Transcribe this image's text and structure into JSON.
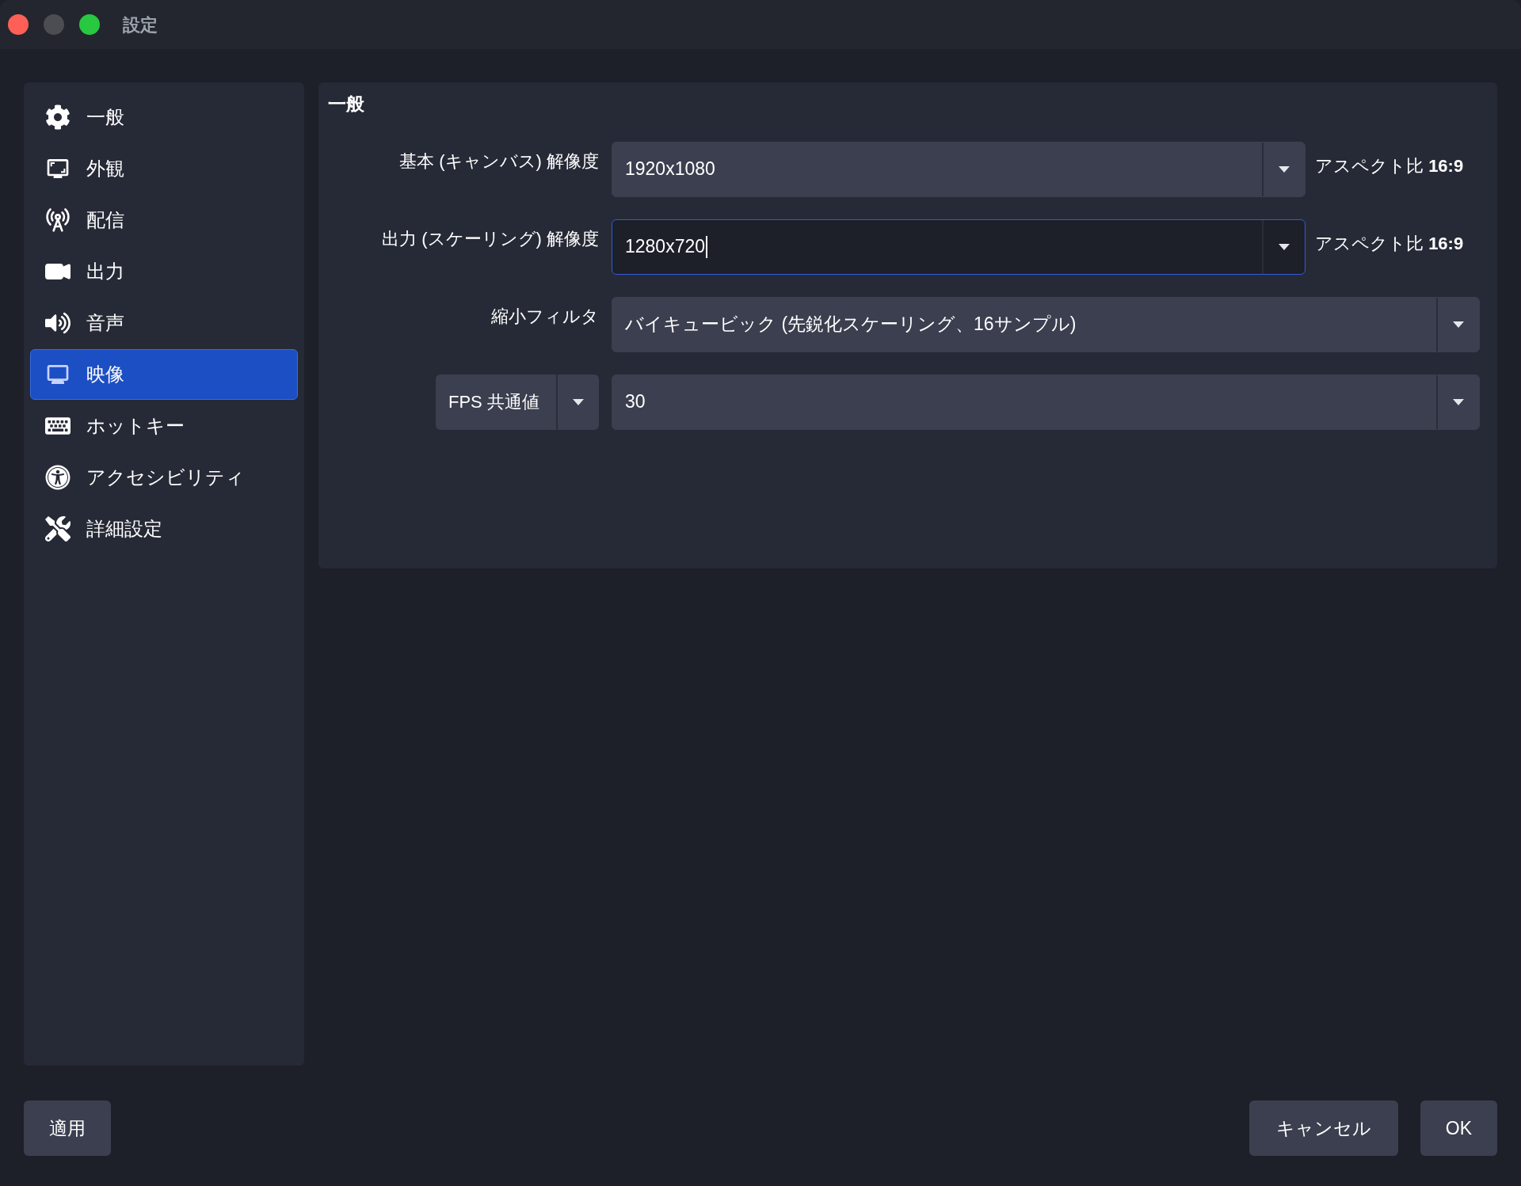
{
  "window": {
    "title": "設定"
  },
  "sidebar": {
    "items": [
      {
        "label": "一般",
        "selected": false
      },
      {
        "label": "外観",
        "selected": false
      },
      {
        "label": "配信",
        "selected": false
      },
      {
        "label": "出力",
        "selected": false
      },
      {
        "label": "音声",
        "selected": false
      },
      {
        "label": "映像",
        "selected": true
      },
      {
        "label": "ホットキー",
        "selected": false
      },
      {
        "label": "アクセシビリティ",
        "selected": false
      },
      {
        "label": "詳細設定",
        "selected": false
      }
    ]
  },
  "section": {
    "title": "一般",
    "rows": [
      {
        "label": "基本 (キャンバス) 解像度",
        "value": "1920x1080",
        "focused": false,
        "note": "アスペクト比 **16:9**"
      },
      {
        "label": "出力 (スケーリング) 解像度",
        "value": "1280x720",
        "focused": true,
        "note": "アスペクト比 **16:9**"
      },
      {
        "label": "縮小フィルタ",
        "value": "バイキュービック (先鋭化スケーリング、16サンプル)",
        "focused": false
      },
      {
        "label_select": "FPS 共通値",
        "value": "30",
        "focused": false
      }
    ]
  },
  "buttons": {
    "apply": "適用",
    "cancel": "キャンセル",
    "ok": "OK"
  }
}
